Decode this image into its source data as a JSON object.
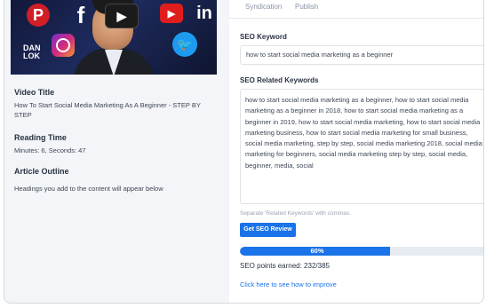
{
  "tabs": [
    "Syndication",
    "Publish"
  ],
  "thumbnail": {
    "brand_text": "DAN\nLOK",
    "icons": [
      "pinterest-icon",
      "facebook-icon",
      "youtube-play-icon",
      "youtube-icon",
      "linkedin-icon",
      "instagram-icon",
      "twitter-icon"
    ]
  },
  "video": {
    "title_label": "Video Title",
    "title_value": "How To Start Social Media Marketing As A Beginner - STEP BY STEP"
  },
  "reading": {
    "label": "Reading Time",
    "value": "Minutes: 6, Seconds: 47"
  },
  "outline": {
    "label": "Article Outline",
    "value": "Headings you add to the content will appear below"
  },
  "seo": {
    "keyword_label": "SEO Keyword",
    "keyword_value": "how to start social media marketing as a beginner",
    "related_label": "SEO Related Keywords",
    "related_value": "how to start social media marketing as a beginner, how to start social media marketing as a beginner in 2018, how to start social media marketing as a beginner in 2019, how to start social media marketing, how to start social media marketing business, how to start social media marketing for small business, social media marketing, step by step, social media marketing 2018, social media marketing for beginners, social media marketing step by step, social media, beginner, media, social",
    "related_hint": "Separate 'Related Keywords' with commas.",
    "review_button": "Get SEO Review",
    "progress_percent": 60,
    "progress_label": "60%",
    "points_text": "SEO points earned: 232/385",
    "improve_link": "Click here to see how to improve"
  },
  "colors": {
    "accent": "#1a73e8",
    "panel_bg": "#f3f5f8"
  }
}
